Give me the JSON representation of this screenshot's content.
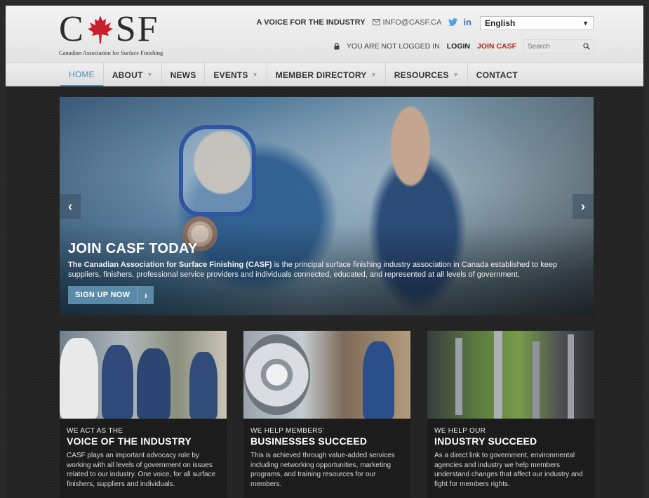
{
  "brand": {
    "logo_text_left": "C",
    "logo_text_right": "SF",
    "logo_subtitle": "Canadian Association for Surface Finishing",
    "maple_color": "#c8202a"
  },
  "topbar": {
    "tagline": "A VOICE FOR THE INDUSTRY",
    "email": "INFO@CASF.CA",
    "twitter_glyph": "𝕥",
    "linkedin_glyph": "in",
    "language": "English",
    "login_status": "YOU ARE NOT LOGGED IN",
    "login_label": "LOGIN",
    "join_label": "JOIN CASF",
    "search_placeholder": "Search"
  },
  "nav": {
    "items": [
      {
        "label": "HOME",
        "active": true,
        "dropdown": false
      },
      {
        "label": "ABOUT",
        "active": false,
        "dropdown": true
      },
      {
        "label": "NEWS",
        "active": false,
        "dropdown": false
      },
      {
        "label": "EVENTS",
        "active": false,
        "dropdown": true
      },
      {
        "label": "MEMBER DIRECTORY",
        "active": false,
        "dropdown": true
      },
      {
        "label": "RESOURCES",
        "active": false,
        "dropdown": true
      },
      {
        "label": "CONTACT",
        "active": false,
        "dropdown": false
      }
    ]
  },
  "hero": {
    "title": "JOIN CASF TODAY",
    "text_bold": "The Canadian Association for Surface Finishing (CASF)",
    "text_rest": " is the principal surface finishing industry association in Canada established to keep suppliers, finishers, professional service providers and individuals connected, educated, and represented at all levels of government.",
    "cta": "SIGN UP NOW",
    "cta_arrow": "›",
    "prev": "‹",
    "next": "›"
  },
  "cards": [
    {
      "pre": "WE ACT AS THE",
      "heading": "VOICE OF THE INDUSTRY",
      "body": "CASF plays an important advocacy role by working with all levels of government on issues related to our industry. One voice, for all surface finishers, suppliers and individuals."
    },
    {
      "pre": "WE HELP MEMBERS'",
      "heading": "BUSINESSES SUCCEED",
      "body": "This is achieved through value-added services including networking opportunities, marketing programs, and training resources for our members."
    },
    {
      "pre": "WE HELP OUR",
      "heading": "INDUSTRY SUCCEED",
      "body": "As a direct link to government, environmental agencies and industry we help members understand changes that affect our industry and fight for members rights."
    }
  ]
}
